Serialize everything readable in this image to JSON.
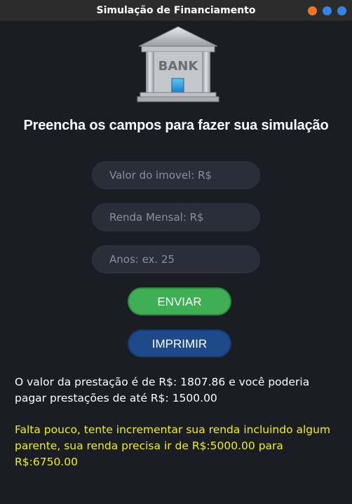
{
  "window": {
    "title": "Simulação de Financiamento",
    "controls": [
      "minimize-icon",
      "maximize-icon",
      "close-icon"
    ],
    "control_colors": [
      "#f37329",
      "#3584e4",
      "#3584e4"
    ]
  },
  "logo": {
    "icon": "bank-icon",
    "text": "BANK"
  },
  "heading": "Preencha os campos para fazer sua simulação",
  "form": {
    "property_value_placeholder": "Valor do imovel: R$",
    "property_value": "",
    "monthly_income_placeholder": "Renda Mensal: R$",
    "monthly_income": "",
    "years_placeholder": "Anos: ex. 25",
    "years": ""
  },
  "buttons": {
    "send_label": "ENVIAR",
    "print_label": "IMPRIMIR"
  },
  "result": {
    "message": "O valor da prestação é de R$: 1807.86 e você poderia pagar prestações de até R$: 1500.00"
  },
  "warning": {
    "message": "Falta pouco, tente incrementar sua renda incluindo algum parente, sua renda precisa ir de R$:5000.00 para R$:6750.00"
  },
  "colors": {
    "background": "#1a1d24",
    "send_button": "#3fae55",
    "print_button": "#1f4a8a",
    "warning_text": "#f2f200"
  }
}
